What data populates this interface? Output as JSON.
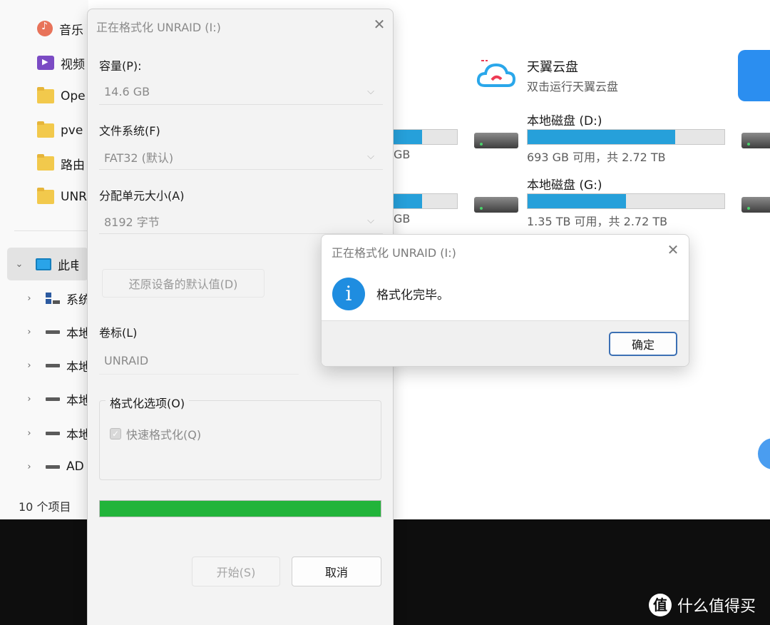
{
  "explorer": {
    "nav_items": [
      {
        "label": "音乐",
        "icon": "music-icon"
      },
      {
        "label": "视频",
        "icon": "video-icon"
      },
      {
        "label": "Ope",
        "icon": "folder-icon"
      },
      {
        "label": "pve",
        "icon": "folder-icon"
      },
      {
        "label": "路由",
        "icon": "folder-icon"
      },
      {
        "label": "UNR",
        "icon": "folder-icon"
      }
    ],
    "tree": {
      "root": {
        "label": "此电",
        "icon": "pc-icon",
        "expanded": true
      },
      "items": [
        {
          "label": "系统",
          "icon": "system-icon"
        },
        {
          "label": "本地",
          "icon": "drive-icon"
        },
        {
          "label": "本地",
          "icon": "drive-icon"
        },
        {
          "label": "本地",
          "icon": "drive-icon"
        },
        {
          "label": "本地",
          "icon": "drive-icon"
        },
        {
          "label": "AD",
          "icon": "drive-icon"
        }
      ]
    },
    "status_count": "10 个项目",
    "cloud_app": {
      "name": "天翼云盘",
      "subtitle": "双击运行天翼云盘"
    },
    "drives": [
      {
        "name": "本地磁盘 (D:)",
        "free_text": "693 GB 可用，共 2.72 TB",
        "used_fraction": 0.75
      },
      {
        "name": "本地磁盘 (G:)",
        "free_text": "1.35 TB 可用，共 2.72 TB",
        "used_fraction": 0.5
      }
    ],
    "partial_drives": [
      {
        "free_text": "GB",
        "used_fraction": 0.5
      },
      {
        "free_text": "GB",
        "used_fraction": 0.5
      }
    ]
  },
  "format_dialog": {
    "title": "正在格式化 UNRAID (I:)",
    "capacity_label": "容量(P):",
    "capacity_value": "14.6 GB",
    "filesystem_label": "文件系统(F)",
    "filesystem_value": "FAT32 (默认)",
    "alloc_label": "分配单元大小(A)",
    "alloc_value": "8192 字节",
    "restore_button": "还原设备的默认值(D)",
    "volume_label": "卷标(L)",
    "volume_value": "UNRAID",
    "options_label": "格式化选项(O)",
    "quick_format_label": "快速格式化(Q)",
    "quick_format_checked": true,
    "progress_fraction": 1.0,
    "progress_color": "#22b43a",
    "start_button": "开始(S)",
    "cancel_button": "取消"
  },
  "message_box": {
    "title": "正在格式化 UNRAID (I:)",
    "icon": "info-icon",
    "message": "格式化完毕。",
    "ok_button": "确定"
  },
  "watermark": {
    "logo_glyph": "值",
    "text": "什么值得买"
  }
}
